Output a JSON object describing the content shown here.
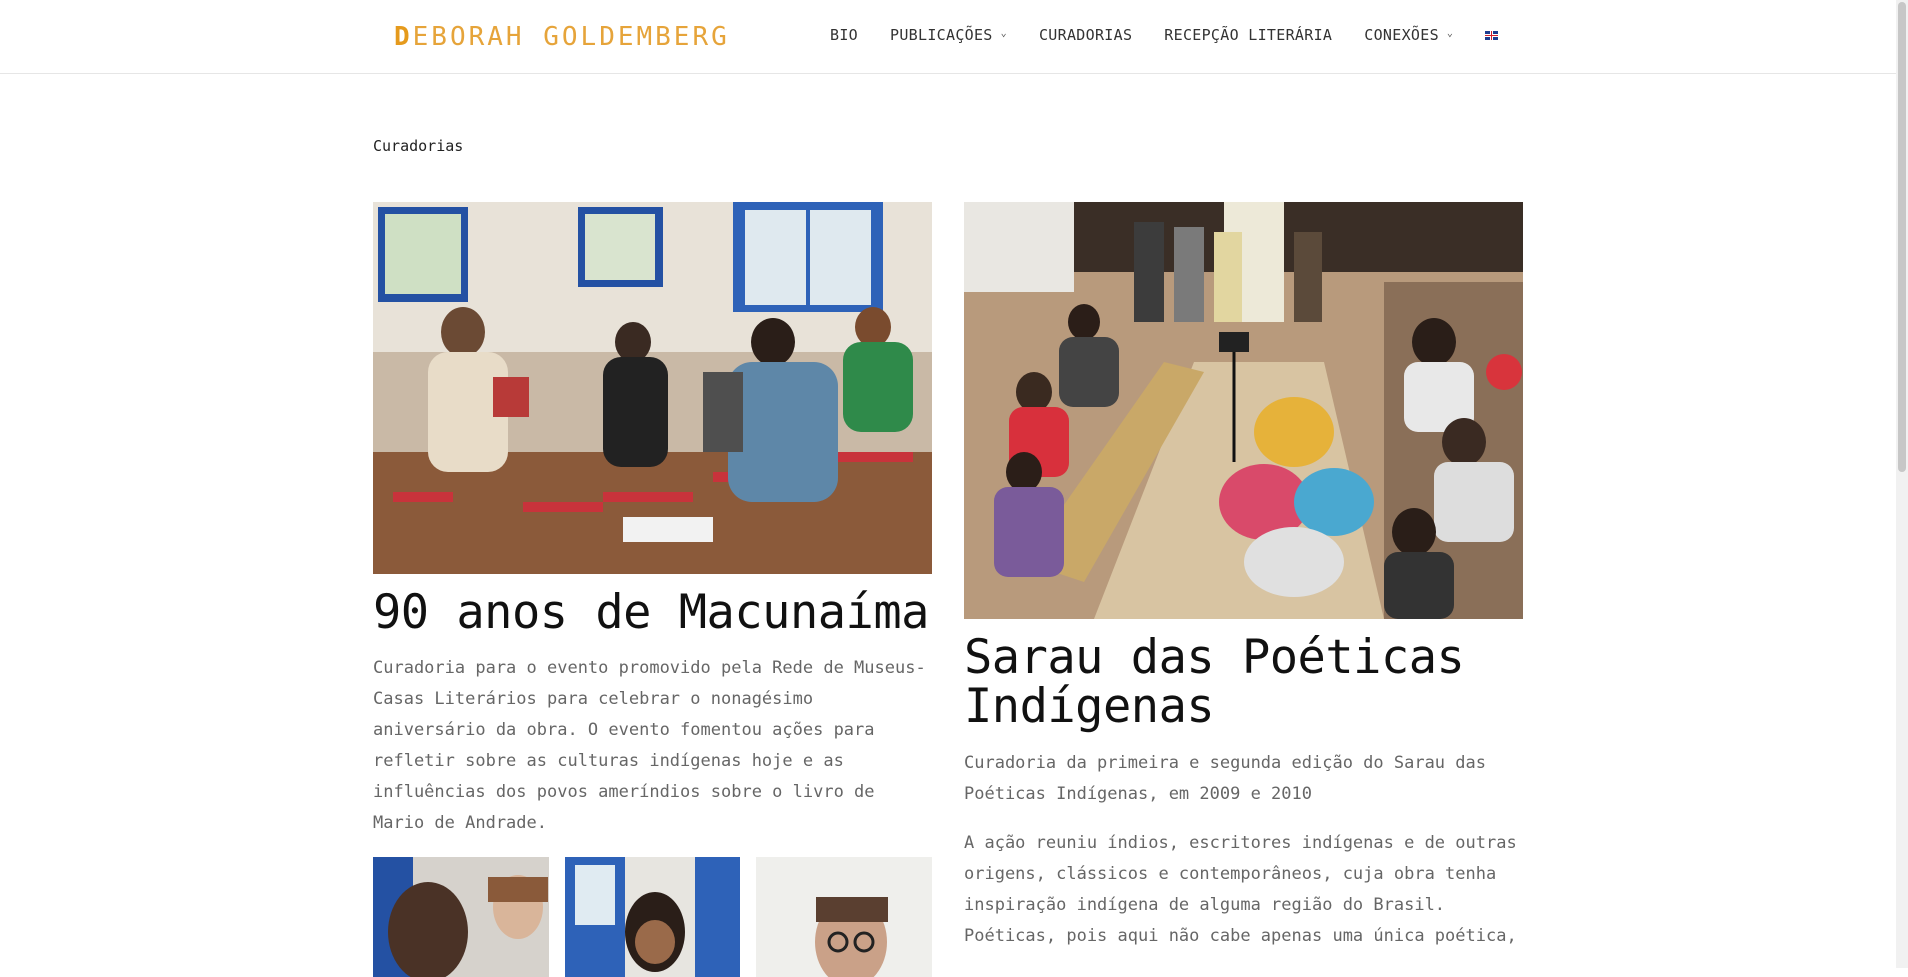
{
  "header": {
    "logo_first": "D",
    "logo_rest": "EBORAH GOLDEMBERG",
    "nav": [
      {
        "label": "BIO",
        "dropdown": false
      },
      {
        "label": "PUBLICAÇÕES",
        "dropdown": true
      },
      {
        "label": "CURADORIAS",
        "dropdown": false
      },
      {
        "label": "RECEPÇÃO LITERÁRIA",
        "dropdown": false
      },
      {
        "label": "CONEXÕES",
        "dropdown": true
      }
    ],
    "language_flag": "uk-flag-icon"
  },
  "page": {
    "label": "Curadorias"
  },
  "posts": [
    {
      "title": "90 anos de Macunaíma",
      "paragraphs": [
        "Curadoria para o evento promovido pela Rede de Museus-Casas Literários para celebrar o nonagésimo aniversário da obra. O evento fomentou ações para refletir sobre as culturas indígenas hoje e as influências dos povos ameríndios sobre o livro de Mario de Andrade."
      ]
    },
    {
      "title": "Sarau das Poéticas Indígenas",
      "paragraphs": [
        "Curadoria da primeira e segunda edição do Sarau das Poéticas  Indígenas, em 2009 e 2010",
        "A ação reuniu índios, escritores indígenas e de outras origens, clássicos e contemporâneos, cuja obra tenha inspiração indígena de alguma região do Brasil. Poéticas, pois aqui não cabe apenas uma única poética,"
      ]
    }
  ],
  "colors": {
    "logo": "#e6a43a",
    "text": "#666666",
    "title": "#111111"
  }
}
